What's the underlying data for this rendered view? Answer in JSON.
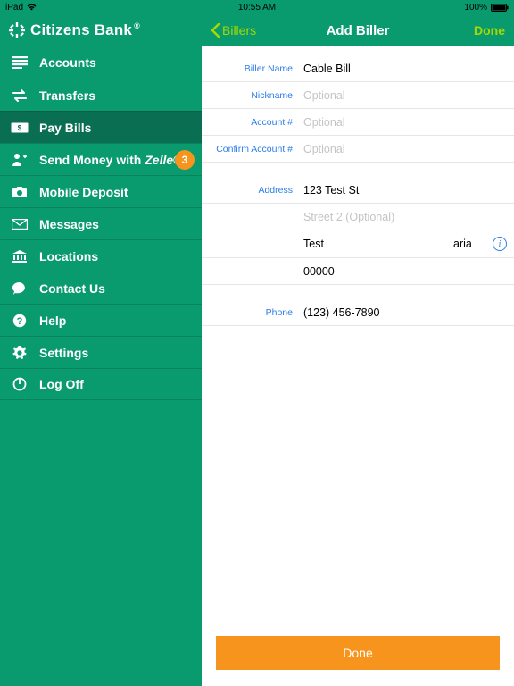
{
  "status": {
    "device": "iPad",
    "time": "10:55 AM",
    "battery": "100%"
  },
  "brand": {
    "name": "Citizens Bank",
    "reg": "®"
  },
  "sidebar": {
    "items": [
      {
        "label": "Accounts"
      },
      {
        "label": "Transfers"
      },
      {
        "label": "Pay Bills"
      },
      {
        "label": "Send Money with "
      },
      {
        "label": "Mobile Deposit"
      },
      {
        "label": "Messages"
      },
      {
        "label": "Locations"
      },
      {
        "label": "Contact Us"
      },
      {
        "label": "Help"
      },
      {
        "label": "Settings"
      },
      {
        "label": "Log Off"
      }
    ],
    "zelle_brand": "Zelle",
    "badge_count": "3"
  },
  "nav": {
    "back": "Billers",
    "title": "Add Biller",
    "done": "Done"
  },
  "form": {
    "labels": {
      "biller_name": "Biller Name",
      "nickname": "Nickname",
      "account": "Account #",
      "confirm_account": "Confirm Account #",
      "address": "Address",
      "phone": "Phone"
    },
    "values": {
      "biller_name": "Cable Bill",
      "nickname": "",
      "account": "",
      "confirm_account": "",
      "address1": "123 Test St",
      "address2": "",
      "city": "Test",
      "state": "aria",
      "zip": "00000",
      "phone": "(123) 456-7890"
    },
    "placeholders": {
      "optional": "Optional",
      "street2": "Street 2 (Optional)"
    },
    "done_button": "Done"
  }
}
